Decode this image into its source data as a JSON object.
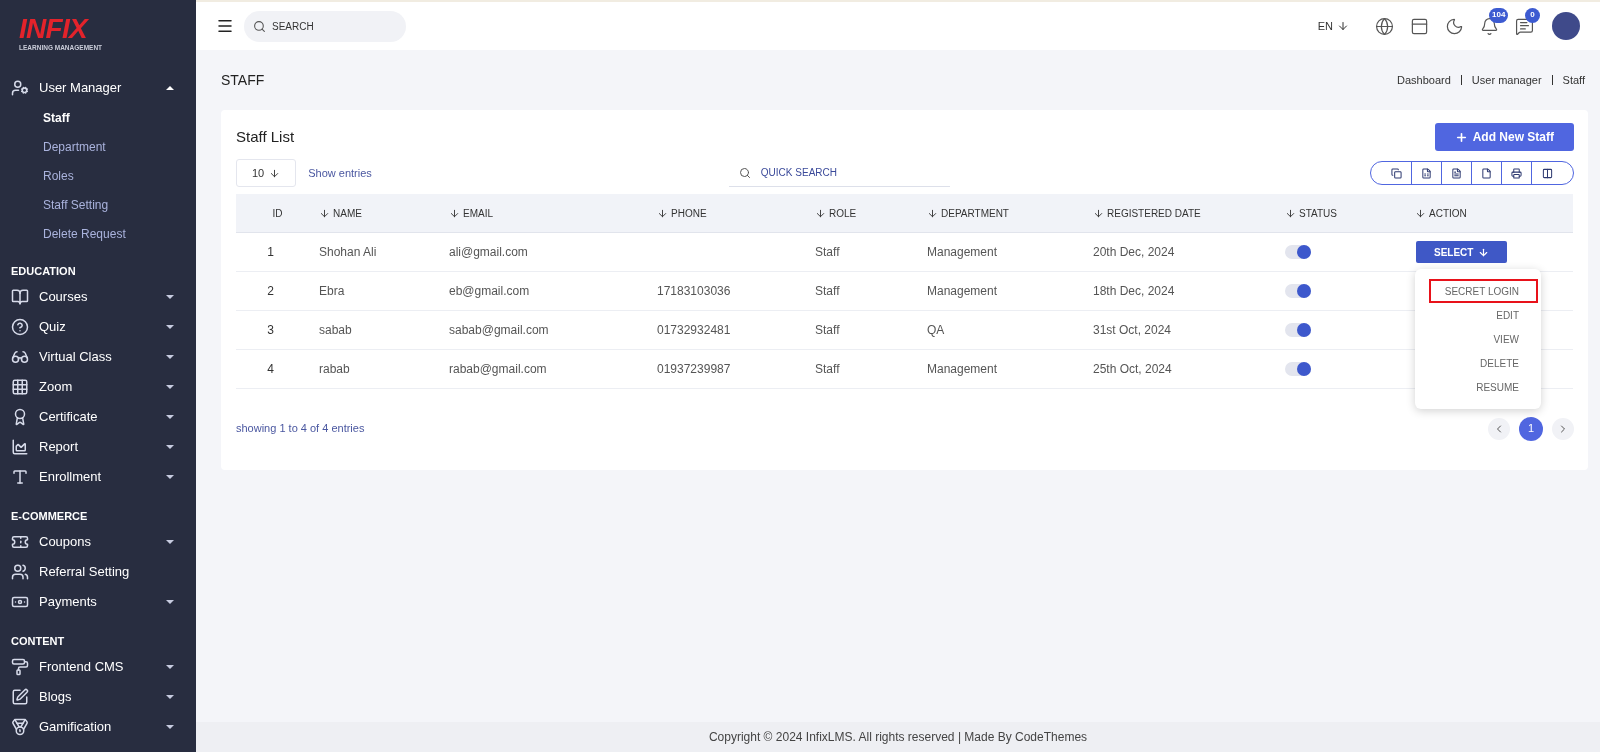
{
  "sidebar": {
    "logo": {
      "name": "INFIX",
      "subtitle": "LEARNING MANAGEMENT"
    },
    "sections": [
      {
        "items": [
          {
            "label": "User Manager",
            "expandable": true,
            "expanded": true,
            "children": [
              {
                "label": "Staff",
                "selected": true
              },
              {
                "label": "Department",
                "selected": false
              },
              {
                "label": "Roles",
                "selected": false
              },
              {
                "label": "Staff Setting",
                "selected": false
              },
              {
                "label": "Delete Request",
                "selected": false
              }
            ]
          }
        ]
      },
      {
        "title": "EDUCATION",
        "items": [
          {
            "label": "Courses",
            "expandable": true,
            "expanded": false
          },
          {
            "label": "Quiz",
            "expandable": true,
            "expanded": false
          },
          {
            "label": "Virtual Class",
            "expandable": true,
            "expanded": false
          },
          {
            "label": "Zoom",
            "expandable": true,
            "expanded": false
          },
          {
            "label": "Certificate",
            "expandable": true,
            "expanded": false
          },
          {
            "label": "Report",
            "expandable": true,
            "expanded": false
          },
          {
            "label": "Enrollment",
            "expandable": true,
            "expanded": false
          }
        ]
      },
      {
        "title": "E-COMMERCE",
        "items": [
          {
            "label": "Coupons",
            "expandable": true,
            "expanded": false
          },
          {
            "label": "Referral Setting",
            "expandable": false
          },
          {
            "label": "Payments",
            "expandable": true,
            "expanded": false
          }
        ]
      },
      {
        "title": "CONTENT",
        "items": [
          {
            "label": "Frontend CMS",
            "expandable": true,
            "expanded": false
          },
          {
            "label": "Blogs",
            "expandable": true,
            "expanded": false
          },
          {
            "label": "Gamification",
            "expandable": true,
            "expanded": false
          }
        ]
      }
    ]
  },
  "header": {
    "search": {
      "placeholder": "SEARCH"
    },
    "language": "EN",
    "notifications": "104",
    "messages": "0"
  },
  "page": {
    "title": "STAFF",
    "breadcrumb": [
      "Dashboard",
      "User manager",
      "Staff"
    ]
  },
  "card": {
    "title": "Staff List",
    "add_button": "Add New Staff",
    "page_size": "10",
    "show_entries": "Show entries",
    "search": {
      "placeholder": "QUICK SEARCH"
    },
    "table": {
      "columns": [
        {
          "label": "ID",
          "sortable": false
        },
        {
          "label": "NAME",
          "sortable": true
        },
        {
          "label": "EMAIL",
          "sortable": true
        },
        {
          "label": "PHONE",
          "sortable": true
        },
        {
          "label": "ROLE",
          "sortable": true
        },
        {
          "label": "DEPARTMENT",
          "sortable": true
        },
        {
          "label": "REGISTERED DATE",
          "sortable": true
        },
        {
          "label": "STATUS",
          "sortable": true
        },
        {
          "label": "ACTION",
          "sortable": true
        }
      ],
      "rows": [
        {
          "id": "1",
          "name": "Shohan Ali",
          "email": "ali@gmail.com",
          "role": "Staff",
          "department": "Management",
          "date": "20th Dec, 2024",
          "status_on": true,
          "action": "SELECT"
        },
        {
          "id": "2",
          "name": "Ebra",
          "email": "eb@gmail.com",
          "phone": "17183103036",
          "role": "Staff",
          "department": "Management",
          "date": "18th Dec, 2024",
          "status_on": true
        },
        {
          "id": "3",
          "name": "sabab",
          "email": "sabab@gmail.com",
          "phone": "01732932481",
          "role": "Staff",
          "department": "QA",
          "date": "31st Oct, 2024",
          "status_on": true
        },
        {
          "id": "4",
          "name": "rabab",
          "email": "rabab@gmail.com",
          "phone": "01937239987",
          "role": "Staff",
          "department": "Management",
          "date": "25th Oct, 2024",
          "status_on": true
        }
      ]
    },
    "action_menu": [
      {
        "label": "SECRET LOGIN",
        "outlined": true
      },
      {
        "label": "EDIT",
        "outlined": false
      },
      {
        "label": "VIEW",
        "outlined": false
      },
      {
        "label": "DELETE",
        "outlined": false
      },
      {
        "label": "RESUME",
        "outlined": false
      }
    ],
    "summary": "showing 1 to 4 of 4 entries",
    "pages": [
      {
        "label": "1",
        "selected": true
      }
    ]
  },
  "footer": "Copyright © 2024 InfixLMS. All rights reserved | Made By CodeThemes"
}
